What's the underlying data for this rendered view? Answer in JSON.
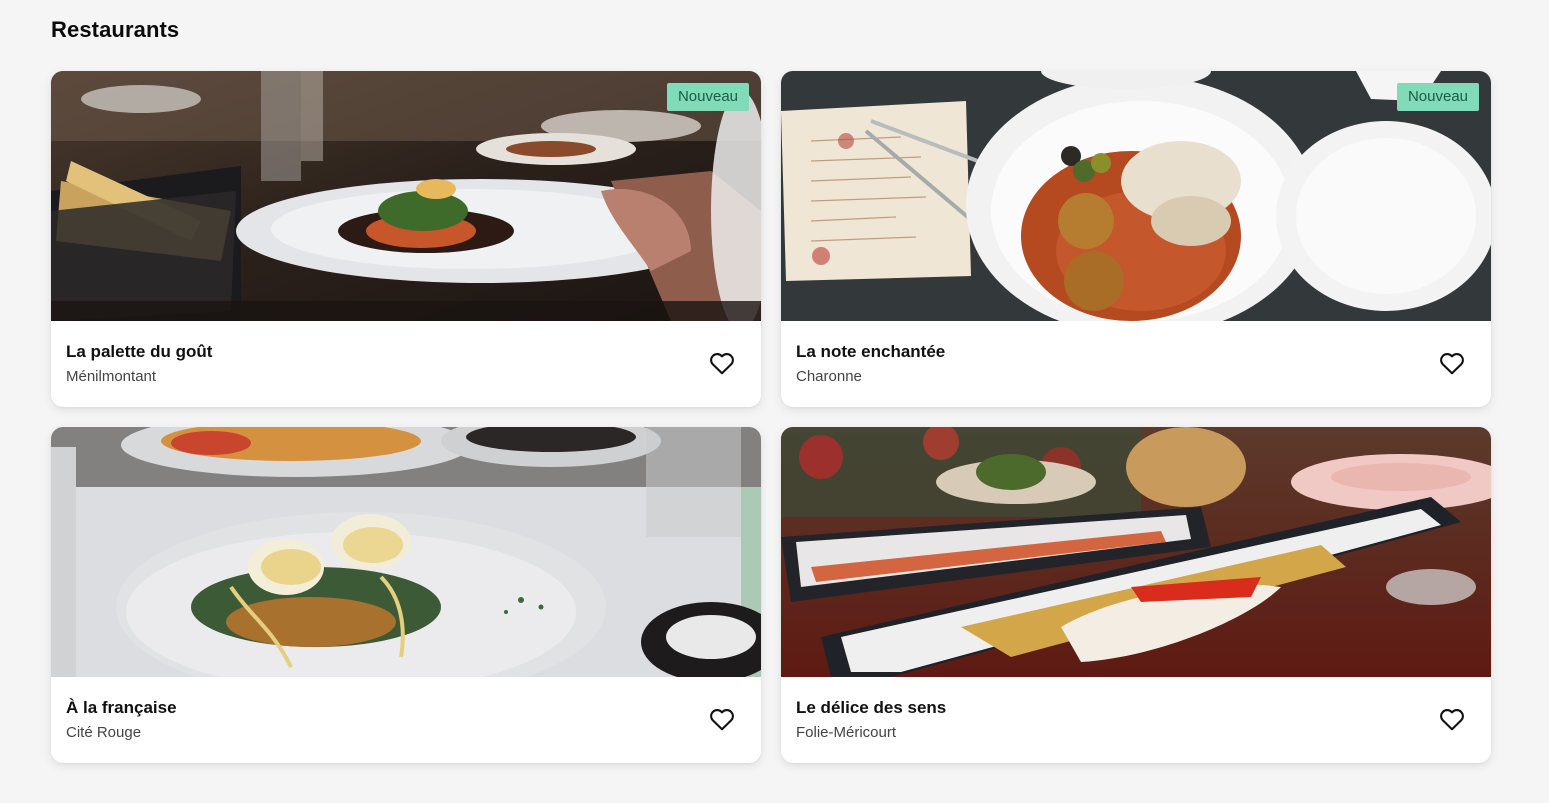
{
  "page": {
    "title": "Restaurants"
  },
  "colors": {
    "background": "#f5f5f5",
    "card": "#ffffff",
    "badge_bg": "#80dbb8",
    "badge_text": "#1c5c47"
  },
  "restaurants": [
    {
      "name": "La palette du goût",
      "neighborhood": "Ménilmontant",
      "badge": "Nouveau",
      "favorite_icon": "heart-outline-icon"
    },
    {
      "name": "La note enchantée",
      "neighborhood": "Charonne",
      "badge": "Nouveau",
      "favorite_icon": "heart-outline-icon"
    },
    {
      "name": "À la française",
      "neighborhood": "Cité Rouge",
      "badge": "",
      "favorite_icon": "heart-outline-icon"
    },
    {
      "name": "Le délice des sens",
      "neighborhood": "Folie-Méricourt",
      "badge": "",
      "favorite_icon": "heart-outline-icon"
    }
  ]
}
